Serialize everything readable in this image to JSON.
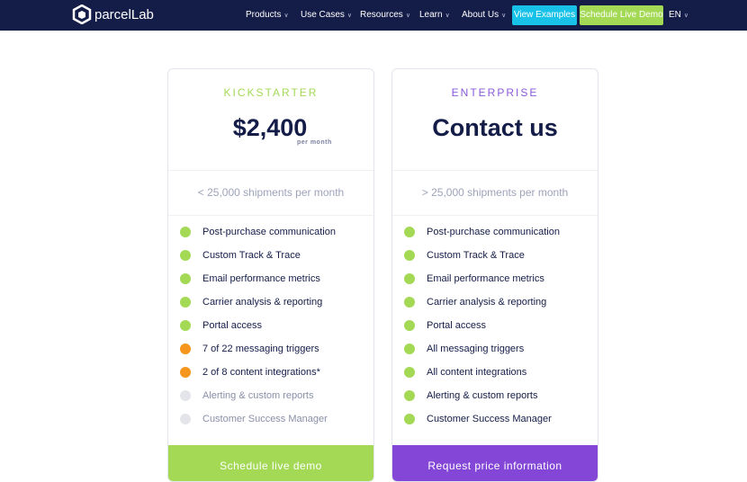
{
  "header": {
    "brand": "parcelLab",
    "nav": [
      "Products",
      "Use Cases",
      "Resources",
      "Learn",
      "About Us"
    ],
    "view_examples": "View Examples",
    "schedule_demo": "Schedule Live Demo",
    "language": "EN"
  },
  "colors": {
    "navy": "#141c48",
    "green": "#a3d955",
    "purple": "#8346d6",
    "orange": "#f7961c",
    "grey": "#e4e5ea",
    "cyan": "#17c1e8"
  },
  "plans": [
    {
      "tier": "KICKSTARTER",
      "price": "$2,400",
      "per": "per month",
      "shipments": "< 25,000 shipments per month",
      "cta": "Schedule live demo",
      "features": [
        {
          "label": "Post-purchase communication",
          "status": "included"
        },
        {
          "label": "Custom Track & Trace",
          "status": "included"
        },
        {
          "label": "Email performance metrics",
          "status": "included"
        },
        {
          "label": "Carrier analysis & reporting",
          "status": "included"
        },
        {
          "label": "Portal access",
          "status": "included"
        },
        {
          "label": "7 of 22 messaging triggers",
          "status": "partial"
        },
        {
          "label": "2 of 8 content integrations*",
          "status": "partial"
        },
        {
          "label": "Alerting & custom reports",
          "status": "excluded"
        },
        {
          "label": "Customer Success Manager",
          "status": "excluded"
        }
      ]
    },
    {
      "tier": "ENTERPRISE",
      "price": "Contact us",
      "shipments": "> 25,000 shipments per month",
      "cta": "Request price information",
      "features": [
        {
          "label": "Post-purchase communication",
          "status": "included"
        },
        {
          "label": "Custom Track & Trace",
          "status": "included"
        },
        {
          "label": "Email performance metrics",
          "status": "included"
        },
        {
          "label": "Carrier analysis & reporting",
          "status": "included"
        },
        {
          "label": "Portal access",
          "status": "included"
        },
        {
          "label": "All messaging triggers",
          "status": "included"
        },
        {
          "label": "All content integrations",
          "status": "included"
        },
        {
          "label": "Alerting & custom reports",
          "status": "included"
        },
        {
          "label": "Customer Success Manager",
          "status": "included"
        }
      ]
    }
  ]
}
